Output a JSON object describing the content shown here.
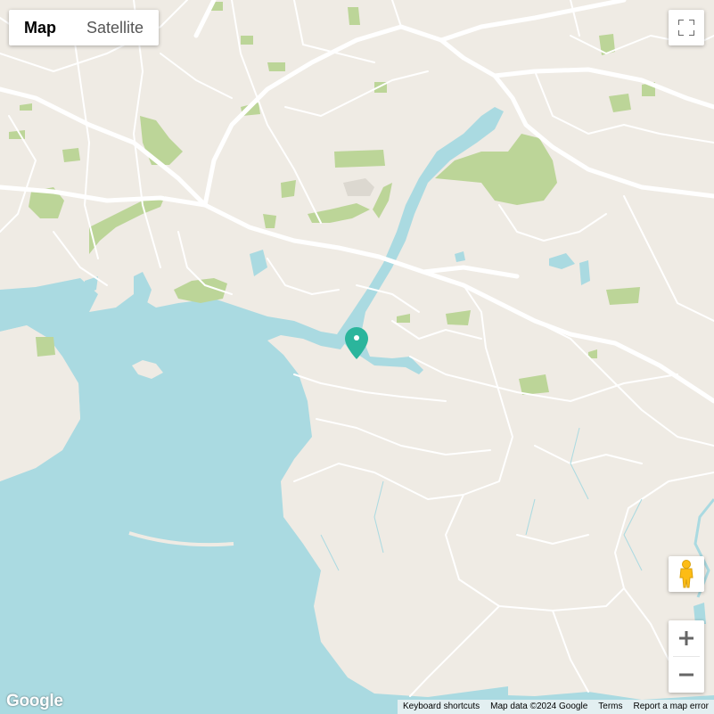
{
  "map_type_control": {
    "map_label": "Map",
    "satellite_label": "Satellite",
    "selected": "Map"
  },
  "controls": {
    "fullscreen_icon": "fullscreen-icon",
    "street_view_icon": "pegman-icon",
    "zoom_in_icon": "plus-icon",
    "zoom_out_icon": "minus-icon"
  },
  "logo_text": "Google",
  "attribution": {
    "keyboard_shortcuts": "Keyboard shortcuts",
    "map_data": "Map data ©2024 Google",
    "terms": "Terms",
    "report": "Report a map error"
  },
  "marker": {
    "icon": "map-pin-icon",
    "color": "#2bb59c"
  },
  "colors": {
    "land": "#efebe4",
    "water": "#aadae1",
    "parks": "#bcd598",
    "roads": "#ffffff",
    "urban": "#e8e4dd"
  }
}
